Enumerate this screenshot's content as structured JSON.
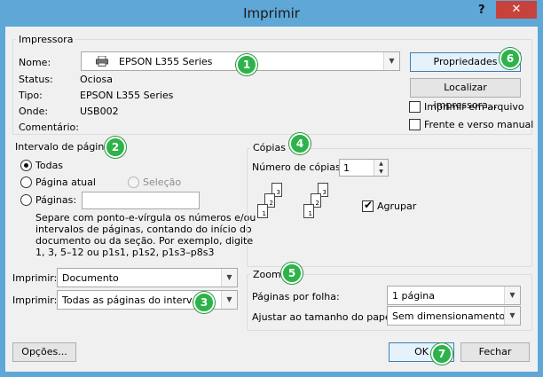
{
  "window": {
    "title": "Imprimir",
    "help": "?",
    "close": "✕"
  },
  "printer": {
    "legend": "Impressora",
    "name_label": "Nome:",
    "name_value": "EPSON L355 Series",
    "status_label": "Status:",
    "status_value": "Ociosa",
    "type_label": "Tipo:",
    "type_value": "EPSON L355 Series",
    "where_label": "Onde:",
    "where_value": "USB002",
    "comment_label": "Comentário:",
    "properties_button": "Propriedades",
    "find_button": "Localizar impressora...",
    "print_to_file": "Imprimir em arquivo",
    "duplex": "Frente e verso manual"
  },
  "range": {
    "legend": "Intervalo de páginas",
    "all": "Todas",
    "current": "Página atual",
    "selection": "Seleção",
    "pages": "Páginas:",
    "pages_value": "",
    "note": [
      "Separe com ponto-e-vírgula os números e/ou",
      "intervalos de páginas, contando do início do",
      "documento ou da seção. Por exemplo, digite",
      "1, 3, 5–12 ou p1s1, p1s2, p1s3–p8s3"
    ]
  },
  "print_what": {
    "label": "Imprimir:",
    "value": "Documento"
  },
  "print_pages": {
    "label": "Imprimir:",
    "value": "Todas as páginas do intervalo"
  },
  "copies": {
    "legend": "Cópias",
    "count_label": "Número de cópias:",
    "count_value": "1",
    "collate": "Agrupar",
    "page_numbers": [
      "1",
      "2",
      "3"
    ]
  },
  "zoom": {
    "legend": "Zoom",
    "per_sheet_label": "Páginas por folha:",
    "per_sheet_value": "1 página",
    "scale_label": "Ajustar ao tamanho do papel:",
    "scale_value": "Sem dimensionamento"
  },
  "footer": {
    "options": "Opções...",
    "ok": "OK",
    "cancel": "Fechar"
  },
  "badges": [
    "1",
    "2",
    "3",
    "4",
    "5",
    "5",
    "6",
    "7"
  ],
  "colors": {
    "titlebar": "#5ea7d7",
    "close": "#c7423c",
    "badge": "#2db34a"
  }
}
